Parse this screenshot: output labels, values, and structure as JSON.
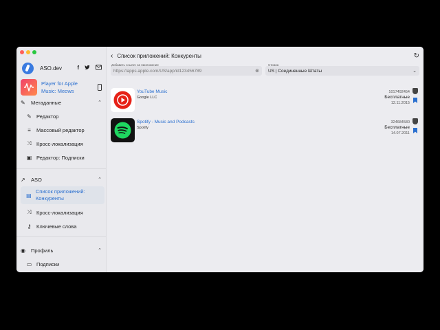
{
  "sidebar": {
    "brand": "ASO.dev",
    "current_app": "Player for Apple Music: Meows",
    "sections": {
      "metadata": "Метаданные",
      "aso": "ASO",
      "profile": "Профиль"
    },
    "items": [
      {
        "label": "Редактор",
        "icon": "pencil-icon"
      },
      {
        "label": "Массовый редактор",
        "icon": "bulk-edit-icon"
      },
      {
        "label": "Кросс-локализация",
        "icon": "shuffle-icon"
      },
      {
        "label": "Редактор: Подписки",
        "icon": "subscription-icon"
      },
      {
        "label": "Список приложений: Конкуренты",
        "icon": "apps-list-icon"
      },
      {
        "label": "Кросс-локализация",
        "icon": "shuffle-icon"
      },
      {
        "label": "Ключевые слова",
        "icon": "key-icon"
      },
      {
        "label": "Подписки",
        "icon": "card-icon"
      }
    ]
  },
  "header": {
    "title": "Список приложений: Конкуренты"
  },
  "form": {
    "link_label": "Добавить ссылку на приложение",
    "link_placeholder": "https://apps.apple.com/US/app/id123456789",
    "country_label": "Страна",
    "country_value": "US | Соединенные Штаты"
  },
  "apps": [
    {
      "title": "YouTube Music",
      "developer": "Google LLC",
      "id": "1017492454",
      "price": "Бесплатные",
      "date": "12.11.2015"
    },
    {
      "title": "Spotify - Music and Podcasts",
      "developer": "Spotify",
      "id": "324684580",
      "price": "Бесплатные",
      "date": "14.07.2011"
    }
  ]
}
